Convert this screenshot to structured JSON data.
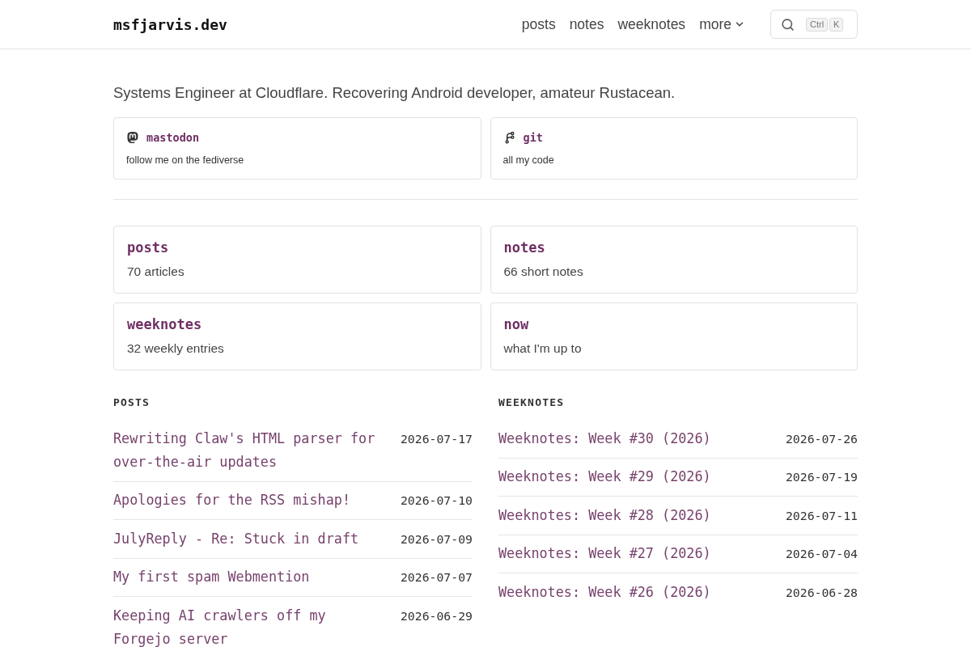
{
  "header": {
    "logo": "msfjarvis.dev",
    "nav": [
      {
        "label": "posts",
        "kind": "link"
      },
      {
        "label": "notes",
        "kind": "link"
      },
      {
        "label": "weeknotes",
        "kind": "link"
      },
      {
        "label": "more",
        "kind": "menu"
      }
    ],
    "search": {
      "keys": [
        "Ctrl",
        "K"
      ]
    }
  },
  "tagline": "Systems Engineer at Cloudflare. Recovering Android developer, amateur Rustacean.",
  "social_links": [
    {
      "kind": "mastodon",
      "title": "mastodon",
      "description": "follow me on the fediverse"
    },
    {
      "kind": "git",
      "title": "git",
      "description": "all my code"
    }
  ],
  "sections": [
    {
      "title": "posts",
      "description": "70 articles"
    },
    {
      "title": "notes",
      "description": "66 short notes"
    },
    {
      "title": "weeknotes",
      "description": "32 weekly entries"
    },
    {
      "title": "now",
      "description": "what I'm up to"
    }
  ],
  "lists": [
    {
      "heading": "POSTS",
      "items": [
        {
          "title": "Rewriting Claw's HTML parser for over-the-air updates",
          "date": "2026-07-17"
        },
        {
          "title": "Apologies for the RSS mishap!",
          "date": "2026-07-10"
        },
        {
          "title": "JulyReply - Re: Stuck in draft",
          "date": "2026-07-09"
        },
        {
          "title": "My first spam Webmention",
          "date": "2026-07-07"
        },
        {
          "title": "Keeping AI crawlers off my Forgejo server",
          "date": "2026-06-29"
        }
      ]
    },
    {
      "heading": "WEEKNOTES",
      "items": [
        {
          "title": "Weeknotes: Week #30 (2026)",
          "date": "2026-07-26"
        },
        {
          "title": "Weeknotes: Week #29 (2026)",
          "date": "2026-07-19"
        },
        {
          "title": "Weeknotes: Week #28 (2026)",
          "date": "2026-07-11"
        },
        {
          "title": "Weeknotes: Week #27 (2026)",
          "date": "2026-07-04"
        },
        {
          "title": "Weeknotes: Week #26 (2026)",
          "date": "2026-06-28"
        }
      ]
    }
  ]
}
